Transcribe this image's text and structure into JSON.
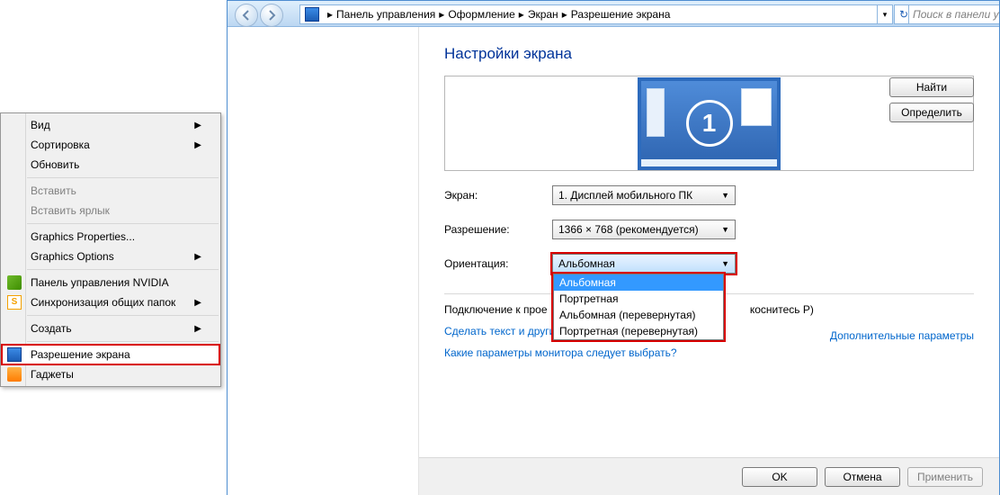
{
  "ctx": {
    "view": "Вид",
    "sort": "Сортировка",
    "refresh": "Обновить",
    "paste": "Вставить",
    "paste_shortcut": "Вставить ярлык",
    "gfx_props": "Graphics Properties...",
    "gfx_opts": "Graphics Options",
    "nvidia": "Панель управления NVIDIA",
    "sync": "Синхронизация общих папок",
    "create": "Создать",
    "resolution": "Разрешение экрана",
    "gadgets": "Гаджеты"
  },
  "breadcrumb": {
    "a": "Панель управления",
    "b": "Оформление",
    "c": "Экран",
    "d": "Разрешение экрана"
  },
  "search_placeholder": "Поиск в панели упр",
  "title": "Настройки экрана",
  "monitor_number": "1",
  "btn_find": "Найти",
  "btn_detect": "Определить",
  "labels": {
    "screen": "Экран:",
    "res": "Разрешение:",
    "orient": "Ориентация:"
  },
  "screen_value": "1. Дисплей мобильного ПК",
  "res_value": "1366 × 768 (рекомендуется)",
  "orient_value": "Альбомная",
  "orient_options": {
    "o1": "Альбомная",
    "o2": "Портретная",
    "o3": "Альбомная (перевернутая)",
    "o4": "Портретная (перевернутая)"
  },
  "link_extra": "Дополнительные параметры",
  "line_proj_a": "Подключение к прое",
  "line_proj_b": " коснитесь P)",
  "link_text_bigger": "Сделать текст и другие элементы больше или меньше",
  "link_which": "Какие параметры монитора следует выбрать?",
  "btn_ok": "OK",
  "btn_cancel": "Отмена",
  "btn_apply": "Применить"
}
